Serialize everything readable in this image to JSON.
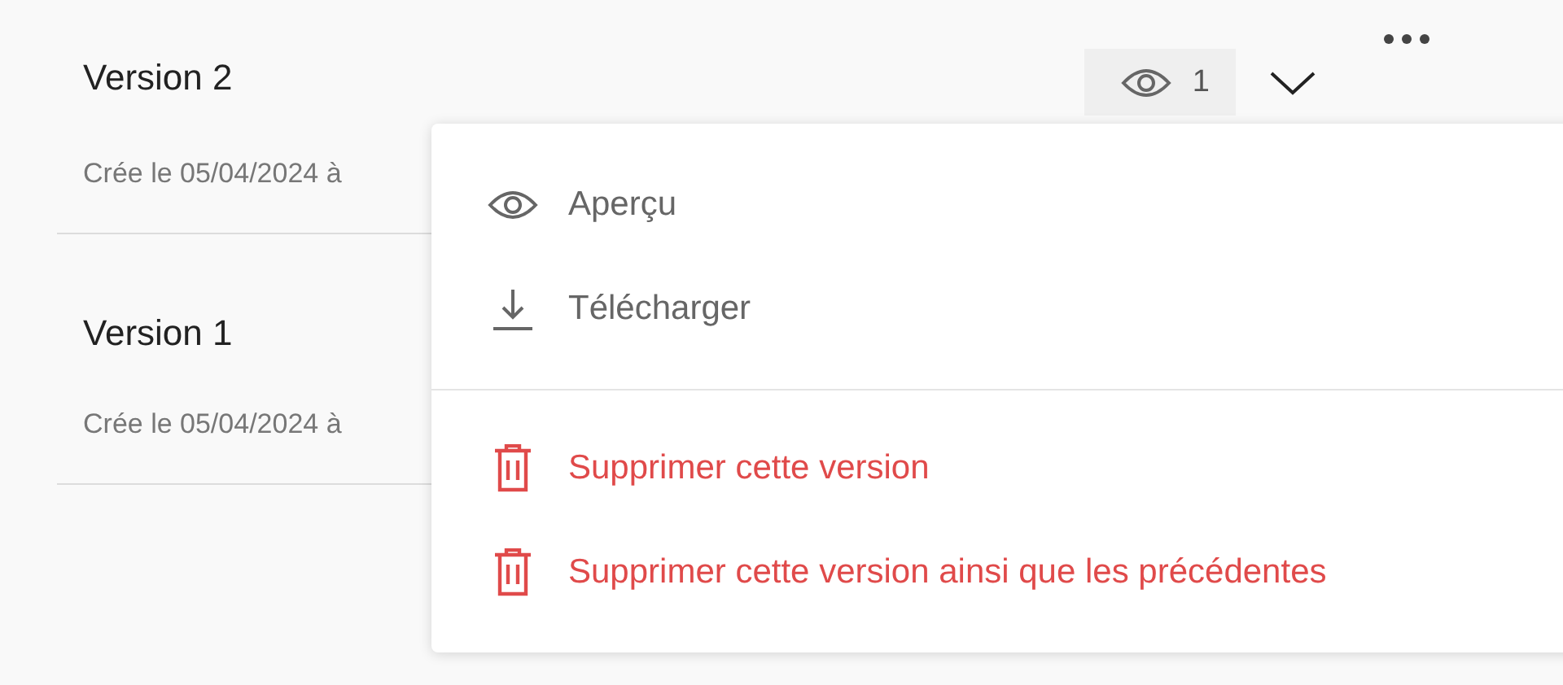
{
  "versions": [
    {
      "title": "Version 2",
      "meta": "Crée le 05/04/2024 à",
      "views": "1"
    },
    {
      "title": "Version 1",
      "meta": "Crée le 05/04/2024 à"
    }
  ],
  "menu": {
    "items": [
      {
        "label": "Aperçu",
        "kind": "preview"
      },
      {
        "label": "Télécharger",
        "kind": "download"
      },
      {
        "label": "Supprimer cette version",
        "kind": "delete"
      },
      {
        "label": "Supprimer cette version ainsi que les précédentes",
        "kind": "delete"
      }
    ]
  }
}
